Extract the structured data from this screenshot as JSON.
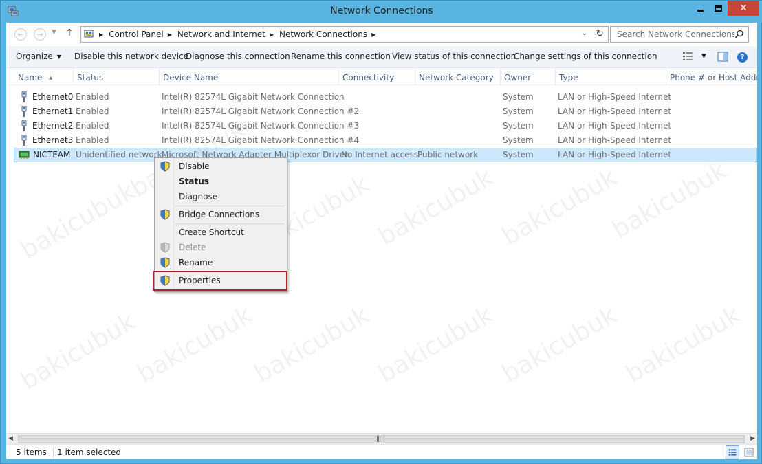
{
  "window": {
    "title": "Network Connections"
  },
  "address": {
    "crumbs": [
      "Control Panel",
      "Network and Internet",
      "Network Connections"
    ]
  },
  "search": {
    "placeholder": "Search Network Connections"
  },
  "toolbar": {
    "organize": "Organize",
    "disable": "Disable this network device",
    "diagnose": "Diagnose this connection",
    "rename": "Rename this connection",
    "view_status": "View status of this connection",
    "change_settings": "Change settings of this connection",
    "help_glyph": "?"
  },
  "columns": [
    "Name",
    "Status",
    "Device Name",
    "Connectivity",
    "Network Category",
    "Owner",
    "Type",
    "Phone # or Host Address"
  ],
  "rows": [
    {
      "name": "Ethernet0",
      "status": "Enabled",
      "device": "Intel(R) 82574L Gigabit Network Connection",
      "connectivity": "",
      "category": "",
      "owner": "System",
      "type": "LAN or High-Speed Internet",
      "icon": "ethernet-cable-icon"
    },
    {
      "name": "Ethernet1",
      "status": "Enabled",
      "device": "Intel(R) 82574L Gigabit Network Connection #2",
      "connectivity": "",
      "category": "",
      "owner": "System",
      "type": "LAN or High-Speed Internet",
      "icon": "ethernet-cable-icon"
    },
    {
      "name": "Ethernet2",
      "status": "Enabled",
      "device": "Intel(R) 82574L Gigabit Network Connection #3",
      "connectivity": "",
      "category": "",
      "owner": "System",
      "type": "LAN or High-Speed Internet",
      "icon": "ethernet-cable-icon"
    },
    {
      "name": "Ethernet3",
      "status": "Enabled",
      "device": "Intel(R) 82574L Gigabit Network Connection #4",
      "connectivity": "",
      "category": "",
      "owner": "System",
      "type": "LAN or High-Speed Internet",
      "icon": "ethernet-cable-icon"
    },
    {
      "name": "NICTEAM",
      "status": "Unidentified network",
      "device": "Microsoft Network Adapter Multiplexor Driver",
      "connectivity": "No Internet access",
      "category": "Public network",
      "owner": "System",
      "type": "LAN or High-Speed Internet",
      "icon": "network-adapter-icon",
      "selected": true
    }
  ],
  "context_menu": {
    "items": [
      {
        "label": "Disable",
        "shield": true,
        "bold": false,
        "disabled": false
      },
      {
        "label": "Status",
        "shield": false,
        "bold": true,
        "disabled": false
      },
      {
        "label": "Diagnose",
        "shield": false,
        "bold": false,
        "disabled": false
      },
      {
        "label": "Bridge Connections",
        "shield": true,
        "bold": false,
        "disabled": false
      },
      {
        "label": "Create Shortcut",
        "shield": false,
        "bold": false,
        "disabled": false
      },
      {
        "label": "Delete",
        "shield": true,
        "bold": false,
        "disabled": true
      },
      {
        "label": "Rename",
        "shield": true,
        "bold": false,
        "disabled": false
      },
      {
        "label": "Properties",
        "shield": true,
        "bold": false,
        "disabled": false,
        "highlighted": true
      }
    ]
  },
  "statusbar": {
    "count": "5 items",
    "selection": "1 item selected"
  },
  "watermark": "bakicubuk",
  "colors": {
    "title_bar": "#59b4e1",
    "selection": "#cce8ff",
    "highlight_box": "#b0242a",
    "close_button": "#c7463a"
  }
}
